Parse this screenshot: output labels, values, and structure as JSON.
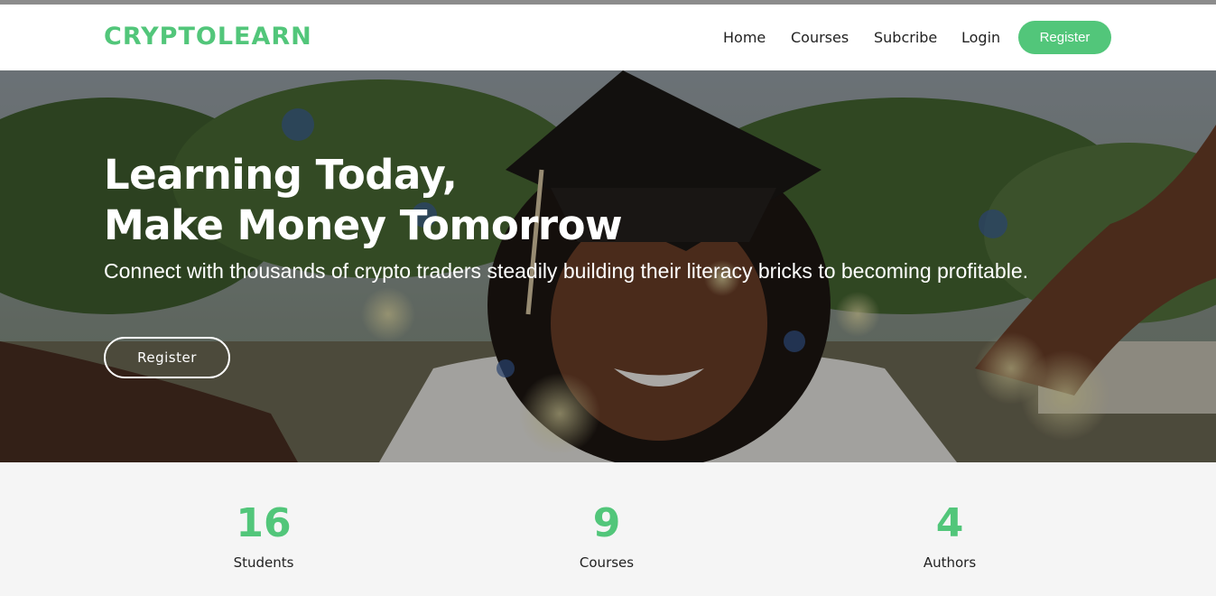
{
  "brand": {
    "logo": "CRYPTOLEARN",
    "accent_color": "#52c67a"
  },
  "nav": {
    "links": [
      "Home",
      "Courses",
      "Subcribe",
      "Login"
    ],
    "register_label": "Register"
  },
  "hero": {
    "title_line1": "Learning Today,",
    "title_line2": "Make Money Tomorrow",
    "subtitle": "Connect with thousands of crypto traders steadily building their literacy bricks to becoming profitable.",
    "button_label": "Register"
  },
  "stats": [
    {
      "value": "16",
      "label": "Students"
    },
    {
      "value": "9",
      "label": "Courses"
    },
    {
      "value": "4",
      "label": "Authors"
    }
  ]
}
